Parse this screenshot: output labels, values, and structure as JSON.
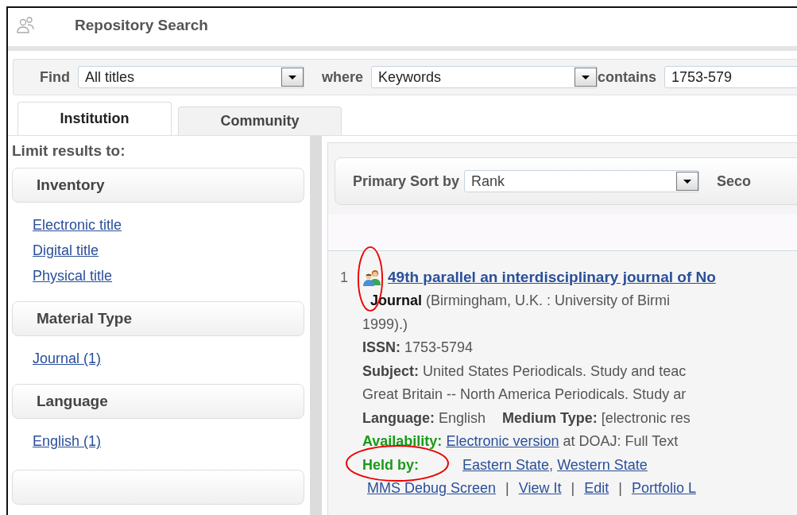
{
  "window": {
    "title": "Repository Search"
  },
  "search": {
    "find_label": "Find",
    "find_value": "All titles",
    "where_label": "where",
    "where_value": "Keywords",
    "contains_label": "contains",
    "contains_value": "1753-579"
  },
  "tabs": [
    {
      "label": "Institution",
      "selected": true
    },
    {
      "label": "Community",
      "selected": false
    }
  ],
  "sidebar": {
    "heading": "Limit results to:",
    "sections": [
      {
        "title": "Inventory",
        "links": [
          "Electronic title",
          "Digital title",
          "Physical title"
        ]
      },
      {
        "title": "Material Type",
        "links": [
          "Journal (1)"
        ]
      },
      {
        "title": "Language",
        "links": [
          "English (1)"
        ]
      }
    ]
  },
  "sort": {
    "label": "Primary Sort by",
    "value": "Rank",
    "secondary_label": "Seco"
  },
  "result": {
    "number": "1",
    "title": "49th parallel an interdisciplinary journal of No",
    "type": "Journal",
    "publication": "(Birmingham, U.K. : University of Birmi",
    "publication_cont": "1999).)",
    "issn": {
      "label": "ISSN:",
      "value": "1753-5794"
    },
    "subject": {
      "label": "Subject:",
      "lines": [
        "United States Periodicals. Study and teac",
        "Great Britain -- North America Periodicals. Study ar"
      ]
    },
    "language": {
      "label": "Language:",
      "value": "English"
    },
    "medium_type": {
      "label": "Medium Type:",
      "value": "[electronic res"
    },
    "availability": {
      "label": "Availability:",
      "link": "Electronic version",
      "rest": "at DOAJ: Full Text"
    },
    "held_by": {
      "label": "Held by:",
      "links": [
        "Eastern State",
        "Western State"
      ],
      "separator": ","
    },
    "actions": [
      "MMS Debug Screen",
      "View It",
      "Edit",
      "Portfolio L"
    ],
    "action_separator": "|"
  }
}
